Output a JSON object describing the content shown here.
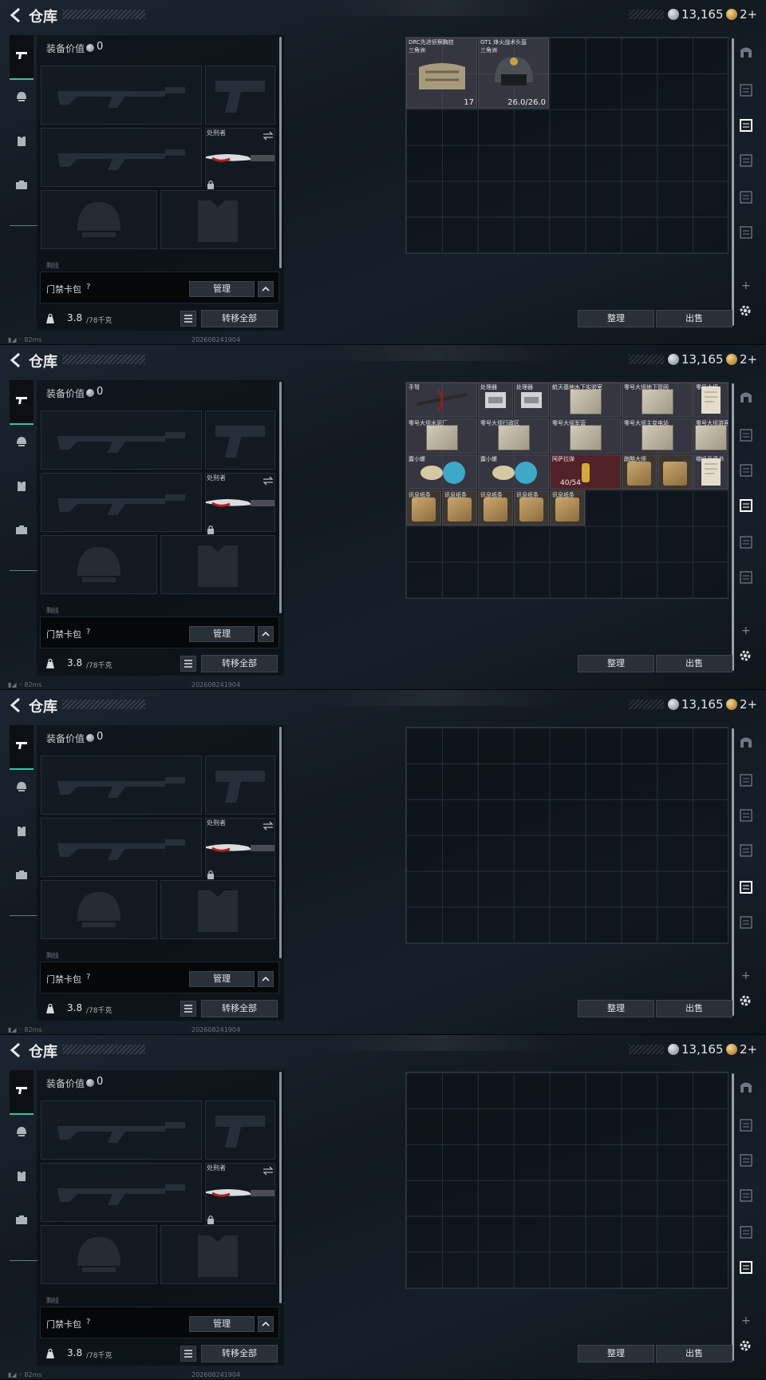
{
  "header": {
    "title": "仓库"
  },
  "currency": {
    "silver": "13,165",
    "gold": "2+"
  },
  "left_tabs": [
    {
      "name": "weapons",
      "icon": "pistol-icon"
    },
    {
      "name": "armor",
      "icon": "helmet-icon"
    },
    {
      "name": "rig",
      "icon": "vest-icon"
    },
    {
      "name": "bag",
      "icon": "briefcase-icon"
    }
  ],
  "equipment": {
    "value_label": "装备价值",
    "value": "0",
    "melee_name": "处刑者",
    "extra_label": "胸挂"
  },
  "pouch": {
    "label": "门禁卡包",
    "help": "?",
    "manage_label": "管理"
  },
  "footer": {
    "weight_value": "3.8",
    "weight_max": "/78千克",
    "transfer_all_label": "转移全部",
    "tidy_label": "整理",
    "sell_label": "出售"
  },
  "status": {
    "ping": "82ms",
    "build": "202608241904"
  },
  "storage_pages": [
    {
      "active_category": 2,
      "items": [
        {
          "name": "DRC先进侦察胸挂",
          "sub": "三角洲",
          "count": "17",
          "art": "vest"
        },
        {
          "name": "GT1 烽火战术头盔",
          "sub": "三角洲",
          "count": "26.0/26.0",
          "art": "helmet"
        }
      ]
    },
    {
      "active_category": 3,
      "items": [
        {
          "name": "手弩",
          "count": "",
          "art": "crossbow"
        },
        {
          "name": "处理器",
          "count": "",
          "art": "device"
        },
        {
          "name": "处理器",
          "count": "",
          "art": "device"
        },
        {
          "name": "航天基地水下实验室",
          "count": "",
          "art": "map"
        },
        {
          "name": "零号大坝地下管网",
          "count": "",
          "art": "map"
        },
        {
          "name": "零号大坝",
          "count": "",
          "art": "doc"
        },
        {
          "name": "零号大坝水泥厂",
          "count": "",
          "art": "map"
        },
        {
          "name": "零号大坝行政区",
          "count": "",
          "art": "map"
        },
        {
          "name": "零号大坝军营",
          "count": "",
          "art": "map"
        },
        {
          "name": "零号大坝主变电站",
          "count": "",
          "art": "map"
        },
        {
          "name": "零号大坝游客中心",
          "count": "",
          "art": "map"
        },
        {
          "name": "露小螺",
          "count": "",
          "art": "toy"
        },
        {
          "name": "露小螺",
          "count": "",
          "art": "toy"
        },
        {
          "name": "阿萨拉弹",
          "count": "40/54",
          "art": "ammo"
        },
        {
          "name": "跑酷大师",
          "count": "",
          "art": "paper"
        },
        {
          "name": "哪吒兵遗书",
          "count": "",
          "art": "doc"
        },
        {
          "name": "讯息纸条",
          "count": "",
          "art": "paper"
        },
        {
          "name": "讯息纸条",
          "count": "",
          "art": "paper"
        },
        {
          "name": "讯息纸条",
          "count": "",
          "art": "paper"
        },
        {
          "name": "讯息纸条",
          "count": "",
          "art": "paper"
        },
        {
          "name": "讯息纸条",
          "count": "",
          "art": "paper"
        }
      ]
    },
    {
      "active_category": 4,
      "items": []
    },
    {
      "active_category": 5,
      "items": []
    }
  ],
  "category_icons": [
    "arch-icon",
    "stash-icon-1",
    "stash-icon-2",
    "stash-icon-3",
    "stash-icon-4",
    "stash-icon-5"
  ],
  "add_label": "+"
}
